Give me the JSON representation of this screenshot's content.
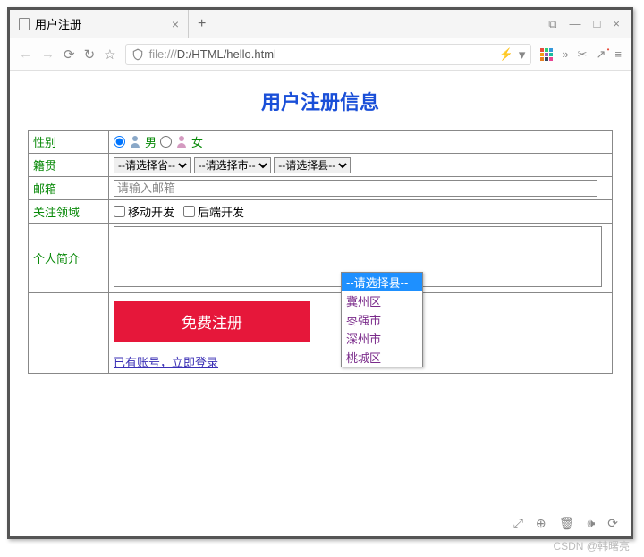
{
  "window": {
    "tab_title": "用户注册",
    "close_tab": "×",
    "new_tab": "+",
    "minimize": "—",
    "maximize": "□",
    "close": "×",
    "popup": "⧉"
  },
  "addrbar": {
    "back": "←",
    "forward": "→",
    "reload": "⟳",
    "reload2": "↻",
    "favorite": "☆",
    "url_prefix": "file:///",
    "url_path": "D:/HTML/hello.html",
    "bolt": "⚡",
    "down": "▾",
    "more": "»",
    "scissors": "✂",
    "arrow": "↗",
    "bookmark_dot": "•",
    "menu": "≡"
  },
  "page": {
    "title": "用户注册信息",
    "labels": {
      "gender": "性别",
      "hometown": "籍贯",
      "email": "邮箱",
      "interest": "关注领域",
      "intro": "个人简介"
    },
    "gender": {
      "male": "男",
      "female": "女"
    },
    "selects": {
      "province": "--请选择省--",
      "city": "--请选择市--",
      "county": "--请选择县--",
      "caret": "⌄"
    },
    "dropdown_options": [
      "--请选择县--",
      "冀州区",
      "枣强市",
      "深州市",
      "桃城区"
    ],
    "email_placeholder": "请输入邮箱",
    "interests": {
      "mobile": "移动开发",
      "backend": "后端开发"
    },
    "submit": "免费注册",
    "login_link": "已有账号，立即登录"
  },
  "statusbar": {
    "i1": "⤢",
    "i2": "⊕",
    "i3": "🗑",
    "i4": "🕪",
    "i5": "⟳"
  },
  "credit": "CSDN @韩曙亮"
}
